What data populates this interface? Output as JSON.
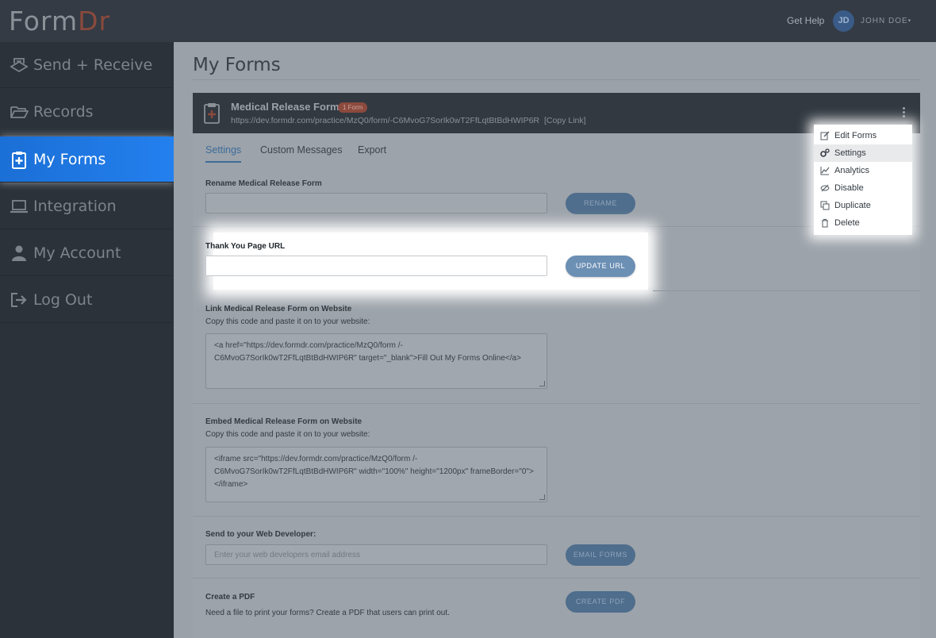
{
  "app": {
    "logo_part1": "Form",
    "logo_part2": "Dr"
  },
  "topbar": {
    "help": "Get Help",
    "avatar_initials": "JD",
    "user_name": "JOHN DOE",
    "caret": "▾"
  },
  "sidebar": {
    "items": [
      {
        "label": "Send + Receive",
        "icon": "send-receive-icon"
      },
      {
        "label": "Records",
        "icon": "folder-open-icon"
      },
      {
        "label": "My Forms",
        "icon": "clipboard-plus-icon",
        "active": true
      },
      {
        "label": "Integration",
        "icon": "laptop-icon"
      },
      {
        "label": "My Account",
        "icon": "user-icon"
      },
      {
        "label": "Log Out",
        "icon": "sign-out-icon"
      }
    ]
  },
  "main": {
    "title": "My Forms",
    "form": {
      "name": "Medical Release Form",
      "badge": "1 Form",
      "url": "https://dev.formdr.com/practice/MzQ0/form/-C6MvoG7SorIk0wT2FfLqtBtBdHWIP6R",
      "copy_link": "[Copy Link]"
    },
    "tabs": [
      {
        "label": "Settings",
        "active": true
      },
      {
        "label": "Custom Messages"
      },
      {
        "label": "Export"
      }
    ],
    "rename": {
      "label": "Rename Medical Release Form",
      "value": "",
      "button": "RENAME"
    },
    "thank_you": {
      "label": "Thank You Page URL",
      "value": "",
      "button": "UPDATE URL"
    },
    "link": {
      "label": "Link Medical Release Form on Website",
      "desc": "Copy this code and paste it on to your website:",
      "code": "<a href=\"https://dev.formdr.com/practice/MzQ0/form /-C6MvoG7SorIk0wT2FfLqtBtBdHWIP6R\" target=\"_blank\">Fill Out My Forms Online</a>"
    },
    "embed": {
      "label": "Embed Medical Release Form on Website",
      "desc": "Copy this code and paste it on to your website:",
      "code": "<iframe src=\"https://dev.formdr.com/practice/MzQ0/form /-C6MvoG7SorIk0wT2FfLqtBtBdHWIP6R\" width=\"100%\" height=\"1200px\" frameBorder=\"0\"></iframe>"
    },
    "developer": {
      "label": "Send to your Web Developer:",
      "placeholder": "Enter your web developers email address",
      "button": "EMAIL FORMS"
    },
    "pdf": {
      "label": "Create a PDF",
      "desc": "Need a file to print your forms? Create a PDF that users can print out.",
      "button": "CREATE PDF"
    }
  },
  "menu": {
    "items": [
      {
        "label": "Edit Forms",
        "icon": "edit-icon"
      },
      {
        "label": "Settings",
        "icon": "cogs-icon",
        "selected": true
      },
      {
        "label": "Analytics",
        "icon": "line-chart-icon"
      },
      {
        "label": "Disable",
        "icon": "eye-slash-icon"
      },
      {
        "label": "Duplicate",
        "icon": "copy-icon"
      },
      {
        "label": "Delete",
        "icon": "trash-icon"
      }
    ]
  },
  "colors": {
    "accent_blue": "#2380ee",
    "topbar": "#343b44",
    "sidebar": "#2b323a",
    "badge": "#8c4a3e"
  }
}
